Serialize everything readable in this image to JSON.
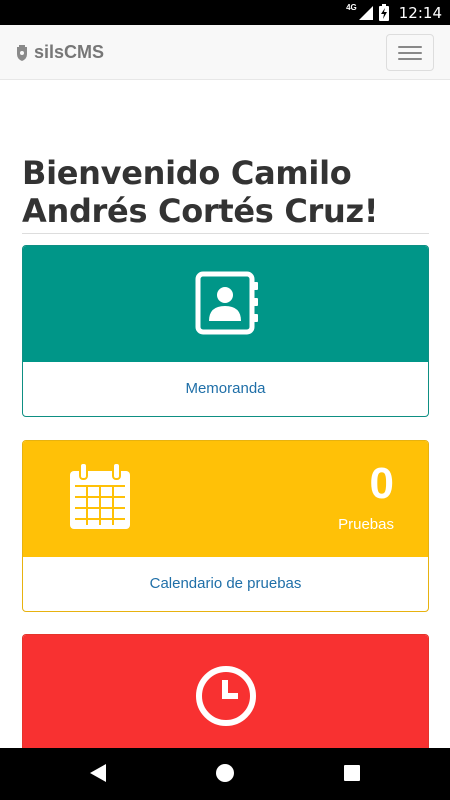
{
  "status_bar": {
    "time": "12:14",
    "network_type": "4G"
  },
  "navbar": {
    "brand": "silsCMS"
  },
  "welcome": {
    "title": "Bienvenido Camilo Andrés Cortés Cruz!"
  },
  "panels": [
    {
      "link": "Memoranda",
      "icon": "contact-book-icon",
      "color": "#009688"
    },
    {
      "count": "0",
      "count_label": "Pruebas",
      "link": "Calendario de pruebas",
      "icon": "calendar-icon",
      "color": "#ffc107"
    },
    {
      "icon": "clock-icon",
      "color": "#f83131"
    }
  ],
  "system_nav": {
    "back": "back-icon",
    "home": "home-icon",
    "recents": "recents-icon"
  }
}
